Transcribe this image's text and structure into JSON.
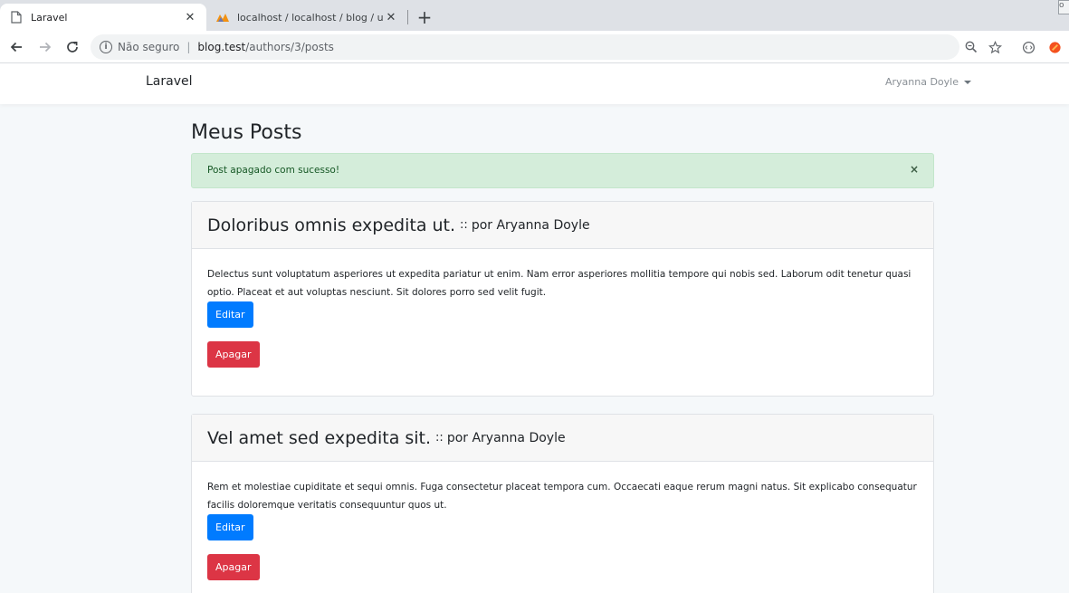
{
  "browser": {
    "tabs": [
      {
        "title": "Laravel",
        "icon": "page-icon",
        "active": true
      },
      {
        "title": "localhost / localhost / blog / use",
        "icon": "phpmyadmin-icon",
        "active": false
      }
    ],
    "new_tab_label": "+",
    "omnibox": {
      "security_label": "Não seguro",
      "url_host": "blog.test",
      "url_path": "/authors/3/posts"
    },
    "window_button_label": "o"
  },
  "app": {
    "brand": "Laravel",
    "user_name": "Aryanna Doyle"
  },
  "page": {
    "title": "Meus Posts",
    "alert": {
      "message": "Post apagado com sucesso!",
      "close_label": "×",
      "color": "#d4edda"
    },
    "posts": [
      {
        "title": "Doloribus omnis expedita ut.",
        "separator": "::",
        "author": "por Aryanna Doyle",
        "body": "Delectus sunt voluptatum asperiores ut expedita pariatur ut enim. Nam error asperiores mollitia tempore qui nobis sed. Laborum odit tenetur quasi optio. Placeat et aut voluptas nesciunt. Sit dolores porro sed velit fugit.",
        "edit_label": "Editar",
        "delete_label": "Apagar"
      },
      {
        "title": "Vel amet sed expedita sit.",
        "separator": "::",
        "author": "por Aryanna Doyle",
        "body": "Rem et molestiae cupiditate et sequi omnis. Fuga consectetur placeat tempora cum. Occaecati eaque rerum magni natus. Sit explicabo consequatur facilis doloremque veritatis consequuntur quos ut.",
        "edit_label": "Editar",
        "delete_label": "Apagar"
      }
    ]
  },
  "colors": {
    "primary": "#007bff",
    "danger": "#dc3545",
    "background": "#f5f8fa"
  }
}
